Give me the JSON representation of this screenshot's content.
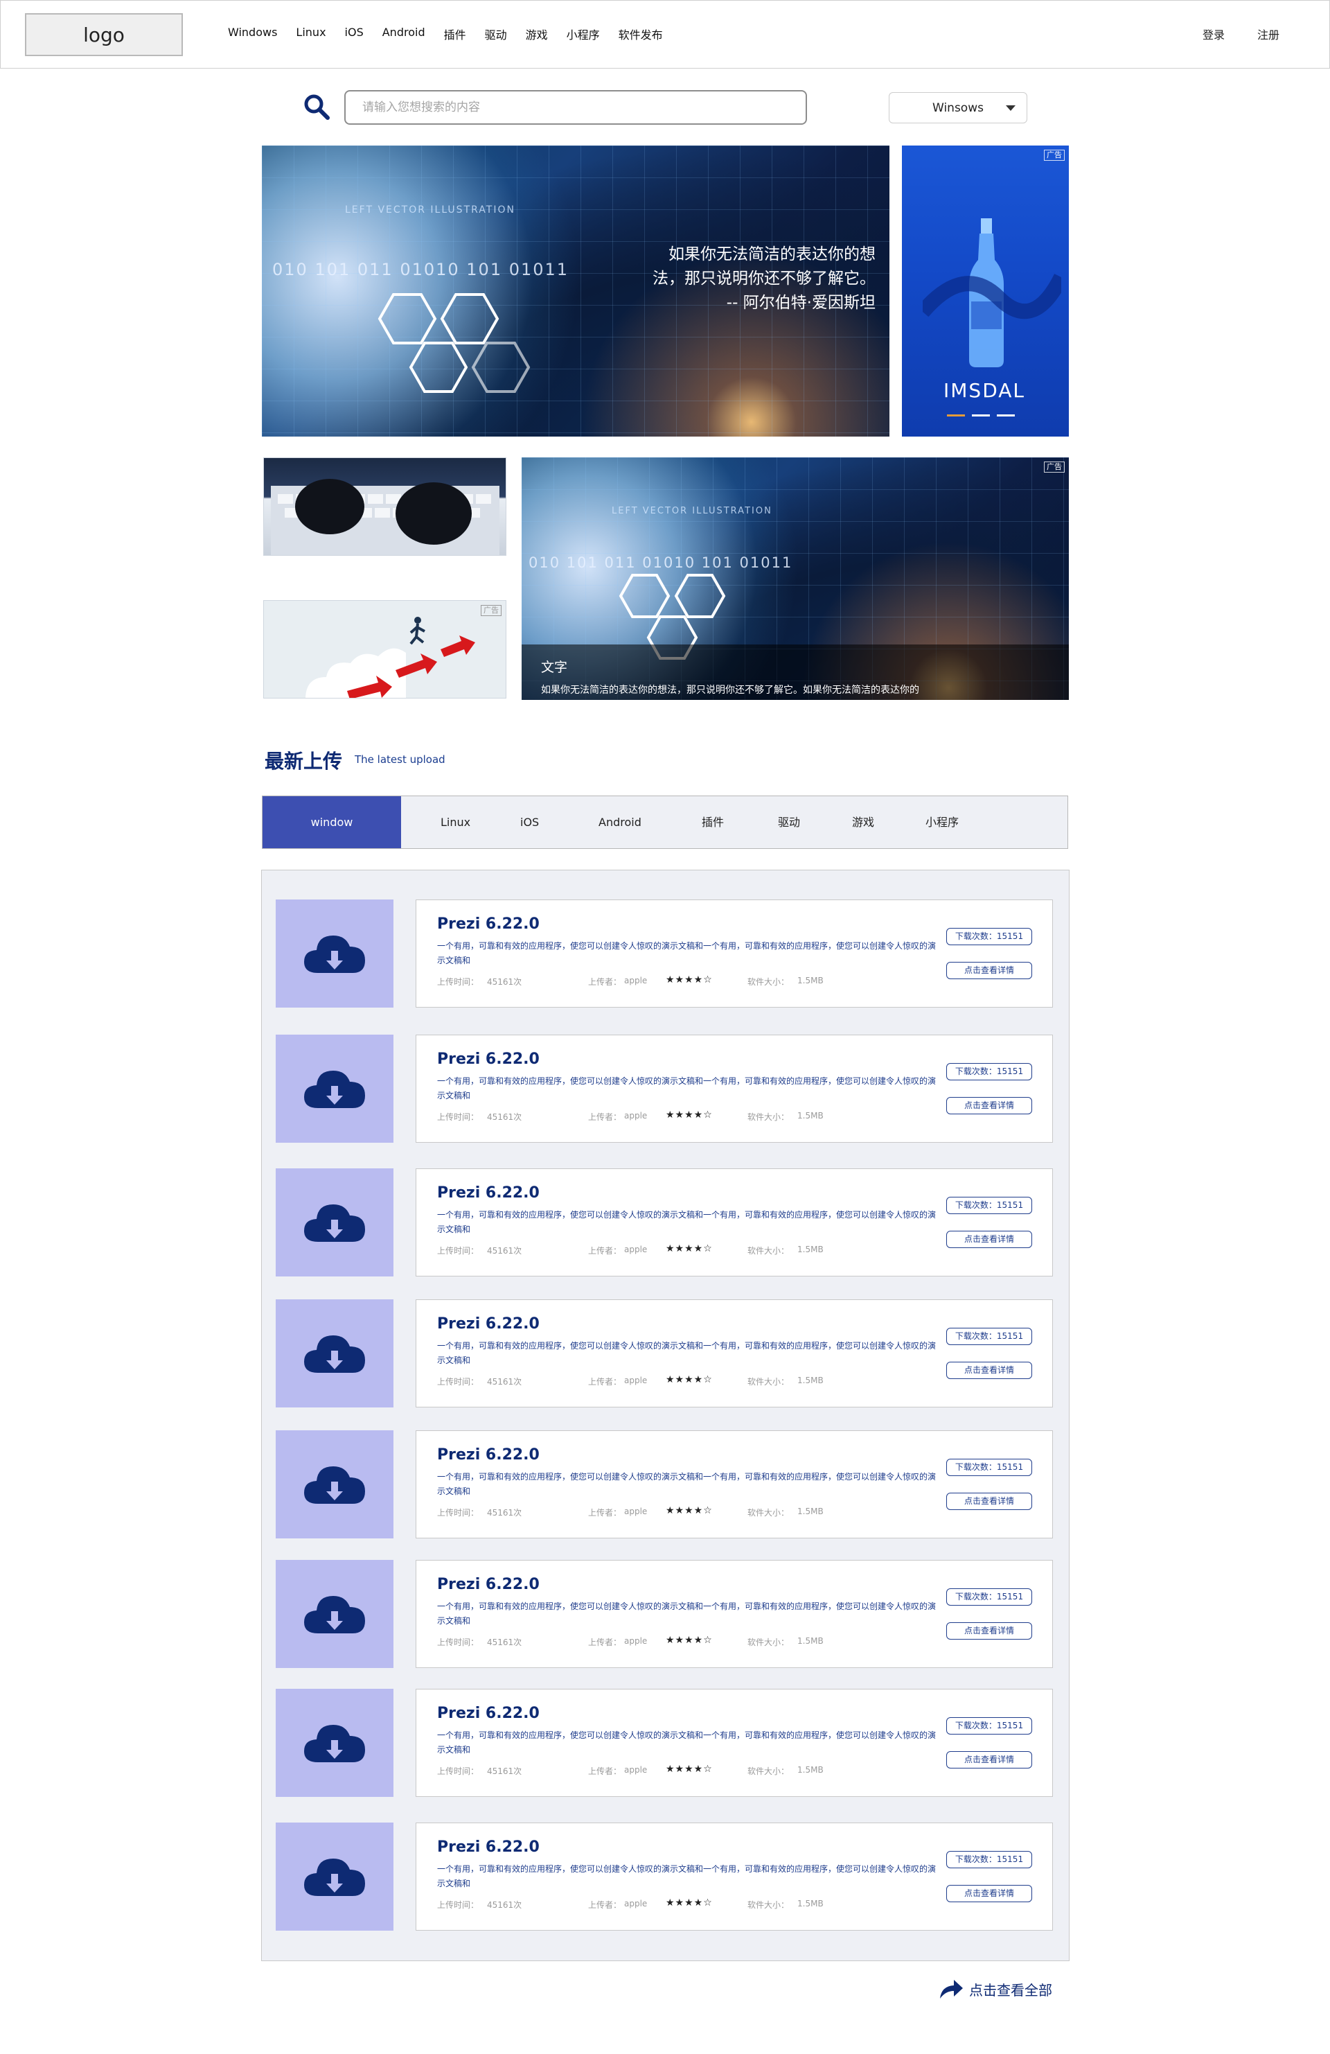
{
  "header": {
    "logo": "logo",
    "nav": [
      "Windows",
      "Linux",
      "iOS",
      "Android",
      "插件",
      "驱动",
      "游戏",
      "小程序",
      "软件发布"
    ],
    "login": "登录",
    "register": "注册"
  },
  "search": {
    "placeholder": "请输入您想搜索的内容",
    "os_selected": "Winsows"
  },
  "banners": {
    "hero_quote": [
      "如果你无法简洁的表达你的想",
      "法，那只说明你还不够了解它。",
      "-- 阿尔伯特·爱因斯坦"
    ],
    "hero_art_text": [
      "LEFT VECTOR ILLUSTRATION",
      "010 101 011 01010 101 01011"
    ],
    "ad_tag": "广告",
    "ad_brand": "IMSDAL",
    "caption_title": "文字",
    "caption_text": "如果你无法简洁的表达你的想法，那只说明你还不够了解它。如果你无法简洁的表达你的"
  },
  "section": {
    "title": "最新上传",
    "subtitle": "The latest upload"
  },
  "tabs": [
    "window",
    "Linux",
    "iOS",
    "Android",
    "插件",
    "驱动",
    "游戏",
    "小程序"
  ],
  "items": [
    {
      "name": "Prezi 6.22.0",
      "desc": "一个有用，可靠和有效的应用程序，使您可以创建令人惊叹的演示文稿和一个有用，可靠和有效的应用程序，使您可以创建令人惊叹的演示文稿和",
      "upload_time_label": "上传时间：",
      "upload_time": "45161次",
      "uploader_label": "上传者：",
      "uploader": "apple",
      "stars": "★★★★☆",
      "size_label": "软件大小：",
      "size": "1.5MB",
      "downloads": "下载次数：15151",
      "detail": "点击查看详情"
    },
    {
      "name": "Prezi 6.22.0",
      "desc": "一个有用，可靠和有效的应用程序，使您可以创建令人惊叹的演示文稿和一个有用，可靠和有效的应用程序，使您可以创建令人惊叹的演示文稿和",
      "upload_time_label": "上传时间：",
      "upload_time": "45161次",
      "uploader_label": "上传者：",
      "uploader": "apple",
      "stars": "★★★★☆",
      "size_label": "软件大小：",
      "size": "1.5MB",
      "downloads": "下载次数：15151",
      "detail": "点击查看详情"
    },
    {
      "name": "Prezi 6.22.0",
      "desc": "一个有用，可靠和有效的应用程序，使您可以创建令人惊叹的演示文稿和一个有用，可靠和有效的应用程序，使您可以创建令人惊叹的演示文稿和",
      "upload_time_label": "上传时间：",
      "upload_time": "45161次",
      "uploader_label": "上传者：",
      "uploader": "apple",
      "stars": "★★★★☆",
      "size_label": "软件大小：",
      "size": "1.5MB",
      "downloads": "下载次数：15151",
      "detail": "点击查看详情"
    },
    {
      "name": "Prezi 6.22.0",
      "desc": "一个有用，可靠和有效的应用程序，使您可以创建令人惊叹的演示文稿和一个有用，可靠和有效的应用程序，使您可以创建令人惊叹的演示文稿和",
      "upload_time_label": "上传时间：",
      "upload_time": "45161次",
      "uploader_label": "上传者：",
      "uploader": "apple",
      "stars": "★★★★☆",
      "size_label": "软件大小：",
      "size": "1.5MB",
      "downloads": "下载次数：15151",
      "detail": "点击查看详情"
    },
    {
      "name": "Prezi 6.22.0",
      "desc": "一个有用，可靠和有效的应用程序，使您可以创建令人惊叹的演示文稿和一个有用，可靠和有效的应用程序，使您可以创建令人惊叹的演示文稿和",
      "upload_time_label": "上传时间：",
      "upload_time": "45161次",
      "uploader_label": "上传者：",
      "uploader": "apple",
      "stars": "★★★★☆",
      "size_label": "软件大小：",
      "size": "1.5MB",
      "downloads": "下载次数：15151",
      "detail": "点击查看详情"
    },
    {
      "name": "Prezi 6.22.0",
      "desc": "一个有用，可靠和有效的应用程序，使您可以创建令人惊叹的演示文稿和一个有用，可靠和有效的应用程序，使您可以创建令人惊叹的演示文稿和",
      "upload_time_label": "上传时间：",
      "upload_time": "45161次",
      "uploader_label": "上传者：",
      "uploader": "apple",
      "stars": "★★★★☆",
      "size_label": "软件大小：",
      "size": "1.5MB",
      "downloads": "下载次数：15151",
      "detail": "点击查看详情"
    },
    {
      "name": "Prezi 6.22.0",
      "desc": "一个有用，可靠和有效的应用程序，使您可以创建令人惊叹的演示文稿和一个有用，可靠和有效的应用程序，使您可以创建令人惊叹的演示文稿和",
      "upload_time_label": "上传时间：",
      "upload_time": "45161次",
      "uploader_label": "上传者：",
      "uploader": "apple",
      "stars": "★★★★☆",
      "size_label": "软件大小：",
      "size": "1.5MB",
      "downloads": "下载次数：15151",
      "detail": "点击查看详情"
    },
    {
      "name": "Prezi 6.22.0",
      "desc": "一个有用，可靠和有效的应用程序，使您可以创建令人惊叹的演示文稿和一个有用，可靠和有效的应用程序，使您可以创建令人惊叹的演示文稿和",
      "upload_time_label": "上传时间：",
      "upload_time": "45161次",
      "uploader_label": "上传者：",
      "uploader": "apple",
      "stars": "★★★★☆",
      "size_label": "软件大小：",
      "size": "1.5MB",
      "downloads": "下载次数：15151",
      "detail": "点击查看详情"
    }
  ],
  "footer": {
    "view_all": "点击查看全部"
  },
  "icons": {
    "search": "search-icon",
    "dropdown": "chevron-down-icon",
    "item_thumb": "cloud-download-icon",
    "view_all": "share-arrow-icon"
  },
  "colors": {
    "brand_navy": "#0e2a73",
    "tab_active": "#3d4fb1",
    "thumb_bg": "#b9bbf0",
    "panel_bg": "#eef0f5"
  }
}
